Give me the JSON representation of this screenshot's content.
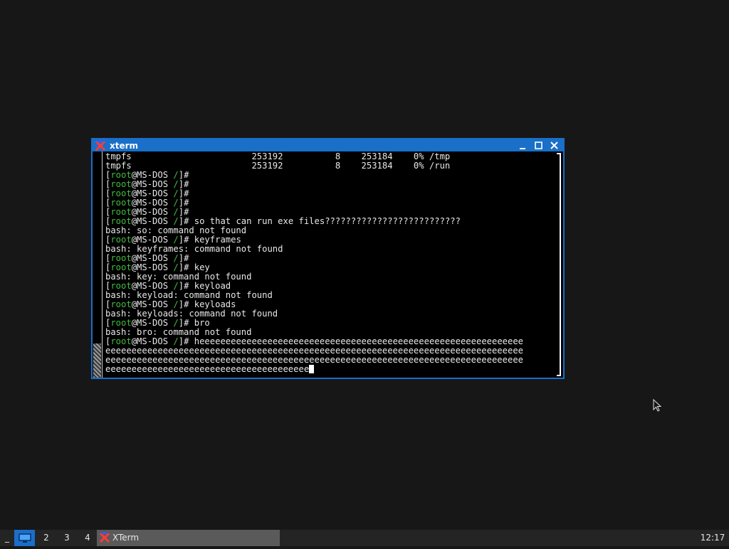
{
  "window": {
    "title": "xterm",
    "icon": "x-logo-icon",
    "buttons": [
      "minimize-icon",
      "maximize-icon",
      "close-icon"
    ]
  },
  "terminal": {
    "lines": [
      [
        {
          "t": "tmpfs                       253192          8    253184    0% /tmp"
        }
      ],
      [
        {
          "t": "tmpfs                       253192          8    253184    0% /run"
        }
      ],
      [
        {
          "t": "["
        },
        {
          "t": "root",
          "c": "u"
        },
        {
          "t": "@MS-DOS "
        },
        {
          "t": "/",
          "c": "u"
        },
        {
          "t": "]#"
        }
      ],
      [
        {
          "t": "["
        },
        {
          "t": "root",
          "c": "u"
        },
        {
          "t": "@MS-DOS "
        },
        {
          "t": "/",
          "c": "u"
        },
        {
          "t": "]#"
        }
      ],
      [
        {
          "t": "["
        },
        {
          "t": "root",
          "c": "u"
        },
        {
          "t": "@MS-DOS "
        },
        {
          "t": "/",
          "c": "u"
        },
        {
          "t": "]#"
        }
      ],
      [
        {
          "t": "["
        },
        {
          "t": "root",
          "c": "u"
        },
        {
          "t": "@MS-DOS "
        },
        {
          "t": "/",
          "c": "u"
        },
        {
          "t": "]#"
        }
      ],
      [
        {
          "t": "["
        },
        {
          "t": "root",
          "c": "u"
        },
        {
          "t": "@MS-DOS "
        },
        {
          "t": "/",
          "c": "u"
        },
        {
          "t": "]#"
        }
      ],
      [
        {
          "t": "["
        },
        {
          "t": "root",
          "c": "u"
        },
        {
          "t": "@MS-DOS "
        },
        {
          "t": "/",
          "c": "u"
        },
        {
          "t": "]# so that can run exe files??????????????????????????"
        }
      ],
      [
        {
          "t": "bash: so: command not found"
        }
      ],
      [
        {
          "t": "["
        },
        {
          "t": "root",
          "c": "u"
        },
        {
          "t": "@MS-DOS "
        },
        {
          "t": "/",
          "c": "u"
        },
        {
          "t": "]# keyframes"
        }
      ],
      [
        {
          "t": "bash: keyframes: command not found"
        }
      ],
      [
        {
          "t": "["
        },
        {
          "t": "root",
          "c": "u"
        },
        {
          "t": "@MS-DOS "
        },
        {
          "t": "/",
          "c": "u"
        },
        {
          "t": "]#"
        }
      ],
      [
        {
          "t": "["
        },
        {
          "t": "root",
          "c": "u"
        },
        {
          "t": "@MS-DOS "
        },
        {
          "t": "/",
          "c": "u"
        },
        {
          "t": "]# key"
        }
      ],
      [
        {
          "t": "bash: key: command not found"
        }
      ],
      [
        {
          "t": "["
        },
        {
          "t": "root",
          "c": "u"
        },
        {
          "t": "@MS-DOS "
        },
        {
          "t": "/",
          "c": "u"
        },
        {
          "t": "]# keyload"
        }
      ],
      [
        {
          "t": "bash: keyload: command not found"
        }
      ],
      [
        {
          "t": "["
        },
        {
          "t": "root",
          "c": "u"
        },
        {
          "t": "@MS-DOS "
        },
        {
          "t": "/",
          "c": "u"
        },
        {
          "t": "]# keyloads"
        }
      ],
      [
        {
          "t": "bash: keyloads: command not found"
        }
      ],
      [
        {
          "t": "["
        },
        {
          "t": "root",
          "c": "u"
        },
        {
          "t": "@MS-DOS "
        },
        {
          "t": "/",
          "c": "u"
        },
        {
          "t": "]# bro"
        }
      ],
      [
        {
          "t": "bash: bro: command not found"
        }
      ],
      [
        {
          "t": "["
        },
        {
          "t": "root",
          "c": "u"
        },
        {
          "t": "@MS-DOS "
        },
        {
          "t": "/",
          "c": "u"
        },
        {
          "t": "]# heeeeeeeeeeeeeeeeeeeeeeeeeeeeeeeeeeeeeeeeeeeeeeeeeeeeeeeeeeeeee"
        }
      ],
      [
        {
          "t": "eeeeeeeeeeeeeeeeeeeeeeeeeeeeeeeeeeeeeeeeeeeeeeeeeeeeeeeeeeeeeeeeeeeeeeeeeeeeeeee"
        }
      ],
      [
        {
          "t": "eeeeeeeeeeeeeeeeeeeeeeeeeeeeeeeeeeeeeeeeeeeeeeeeeeeeeeeeeeeeeeeeeeeeeeeeeeeeeeee"
        }
      ],
      [
        {
          "t": "eeeeeeeeeeeeeeeeeeeeeeeeeeeeeeeeeeeeeee"
        }
      ]
    ],
    "colors": {
      "background": "#000000",
      "text": "#e8e8e8",
      "user": "#3fbf3f"
    }
  },
  "taskbar": {
    "minimize_label": "_",
    "desktops": [
      "2",
      "3",
      "4"
    ],
    "show_desktop_icon": "monitor-icon",
    "task": {
      "label": "XTerm",
      "icon": "x-logo-icon"
    },
    "clock": "12:17"
  },
  "colors": {
    "accent": "#1a6fc8",
    "desktop": "#171717",
    "taskbar": "#242424"
  }
}
